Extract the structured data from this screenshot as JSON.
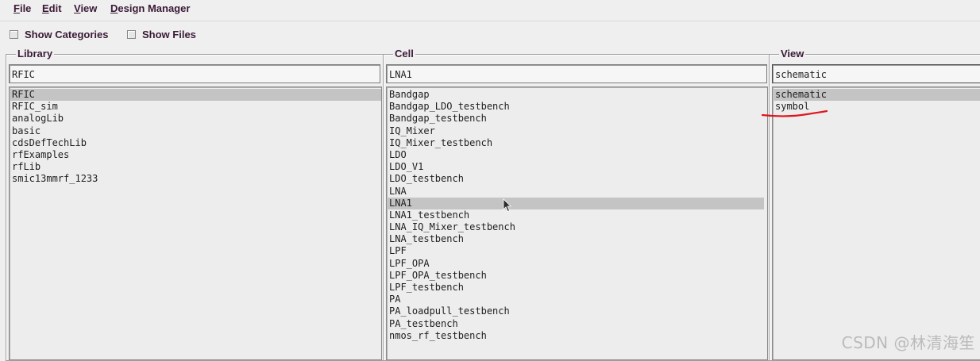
{
  "menu": [
    {
      "label": "File",
      "mnemonic": "F",
      "rest": "ile"
    },
    {
      "label": "Edit",
      "mnemonic": "E",
      "rest": "dit"
    },
    {
      "label": "View",
      "mnemonic": "V",
      "rest": "iew"
    },
    {
      "label": "Design Manager",
      "mnemonic": "D",
      "rest": "esign Manager"
    }
  ],
  "toggles": {
    "show_categories": {
      "label": "Show Categories",
      "checked": false
    },
    "show_files": {
      "label": "Show Files",
      "checked": false
    }
  },
  "library": {
    "title": "Library",
    "filter": "RFIC",
    "items": [
      "RFIC",
      "RFIC_sim",
      "analogLib",
      "basic",
      "cdsDefTechLib",
      "rfExamples",
      "rfLib",
      "smic13mmrf_1233"
    ],
    "selected": "RFIC"
  },
  "cell": {
    "title": "Cell",
    "filter": "LNA1",
    "items": [
      "Bandgap",
      "Bandgap_LDO_testbench",
      "Bandgap_testbench",
      "IQ_Mixer",
      "IQ_Mixer_testbench",
      "LDO",
      "LDO_V1",
      "LDO_testbench",
      "LNA",
      "LNA1",
      "LNA1_testbench",
      "LNA_IQ_Mixer_testbench",
      "LNA_testbench",
      "LPF",
      "LPF_OPA",
      "LPF_OPA_testbench",
      "LPF_testbench",
      "PA",
      "PA_loadpull_testbench",
      "PA_testbench",
      "nmos_rf_testbench"
    ],
    "selected": "LNA1"
  },
  "view": {
    "title": "View",
    "filter": "schematic",
    "items": [
      "schematic",
      "symbol"
    ],
    "selected": "schematic"
  },
  "colors": {
    "menu_text": "#3a1a36",
    "selection": "#c4c4c4",
    "annotation": "#e0141e"
  },
  "watermark": "CSDN @林清海笙"
}
